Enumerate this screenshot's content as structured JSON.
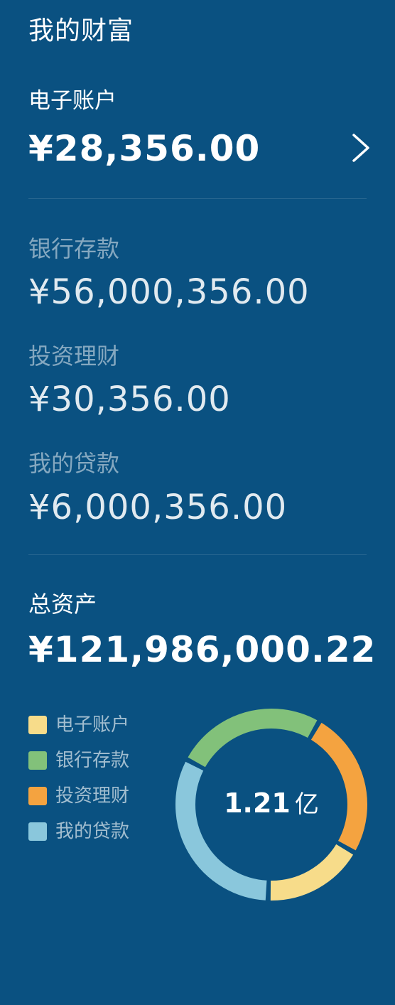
{
  "page_title": "我的财富",
  "electronic_account": {
    "label": "电子账户",
    "amount": "¥28,356.00"
  },
  "bank_deposit": {
    "label": "银行存款",
    "amount": "¥56,000,356.00"
  },
  "investment": {
    "label": "投资理财",
    "amount": "¥30,356.00"
  },
  "loan": {
    "label": "我的贷款",
    "amount": "¥6,000,356.00"
  },
  "total_assets": {
    "label": "总资产",
    "amount": "¥121,986,000.22"
  },
  "donut": {
    "center_value": "1.21",
    "center_unit": "亿",
    "gap_degrees": 3,
    "segments": [
      {
        "label": "银行存款",
        "color": "#82c17a",
        "start_deg": -62,
        "end_deg": 30
      },
      {
        "label": "投资理财",
        "color": "#f4a340",
        "start_deg": 30,
        "end_deg": 120
      },
      {
        "label": "电子账户",
        "color": "#f7dc8a",
        "start_deg": 120,
        "end_deg": 182
      },
      {
        "label": "我的贷款",
        "color": "#8ac7dc",
        "start_deg": 182,
        "end_deg": 298
      }
    ]
  },
  "legend": [
    {
      "label": "电子账户",
      "color": "#f7dc8a"
    },
    {
      "label": "银行存款",
      "color": "#82c17a"
    },
    {
      "label": "投资理财",
      "color": "#f4a340"
    },
    {
      "label": "我的贷款",
      "color": "#8ac7dc"
    }
  ],
  "colors": {
    "background": "#0a5181"
  }
}
